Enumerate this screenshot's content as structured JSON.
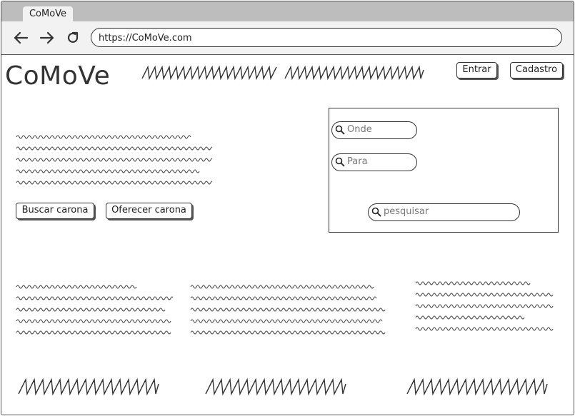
{
  "browser": {
    "tab_title": "CoMoVe",
    "url": "https://CoMoVe.com",
    "nav": {
      "back_icon": "arrow-left-icon",
      "forward_icon": "arrow-right-icon",
      "reload_icon": "reload-icon"
    }
  },
  "header": {
    "logo": "CoMoVe",
    "login_label": "Entrar",
    "signup_label": "Cadastro"
  },
  "hero": {
    "offer_label": "Buscar carona",
    "request_label": "Oferecer carona"
  },
  "search": {
    "from_placeholder": "Onde",
    "to_placeholder": "Para",
    "search_placeholder": "pesquisar",
    "icon": "search-icon"
  }
}
